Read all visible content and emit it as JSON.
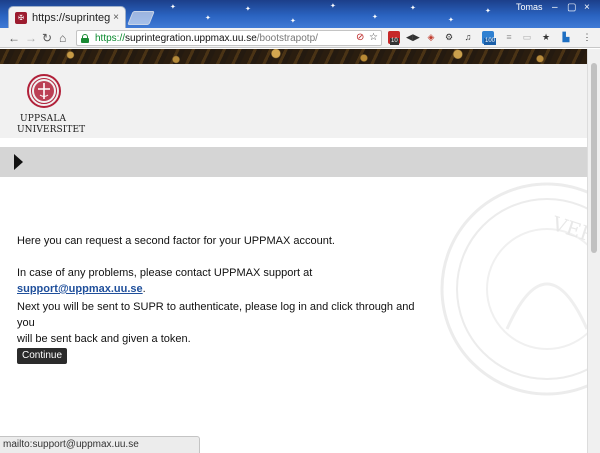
{
  "browser": {
    "tab_title": "https://suprintegra",
    "tab_close": "×",
    "user_label": "Tomas",
    "window_controls": [
      "–",
      "▢",
      "×"
    ],
    "nav": {
      "back": "←",
      "forward": "→",
      "reload": "↻",
      "home": "⌂"
    },
    "url": {
      "secure_prefix": "https://",
      "host": "suprintegration.uppmax.uu.se",
      "path": "/bootstrapotp/"
    },
    "extension_badges": {
      "ext1": "10",
      "ext2": "100"
    },
    "icons": [
      "blocked-popup-icon",
      "bookmark-star-icon",
      "extension-red-icon",
      "arrows-icon",
      "pocket-icon",
      "gear-icon",
      "music-icon",
      "extension-blue-icon",
      "lines-icon",
      "bookmark-star-icon",
      "extension-cast-icon",
      "menu-dots-icon"
    ],
    "status_bar_text": "mailto:support@uppmax.uu.se"
  },
  "logo": {
    "line1": "UPPSALA",
    "line2": "UNIVERSITET",
    "seal_color": "#b1213a"
  },
  "main": {
    "para1": "Here you can request a second factor for your UPPMAX account.",
    "para2_prefix": "In case of any problems, please contact UPPMAX support at ",
    "support_email": "support@uppmax.uu.se",
    "para2_suffix": ".",
    "para3_line1": "Next you will be sent to SUPR to authenticate, please log in and click through and you",
    "para3_line2": "will be sent back and given a token.",
    "continue_label": "Continue"
  },
  "watermark": {
    "letters": "VERITAS UPSALIENSIS"
  },
  "colors": {
    "link": "#1f4f9b",
    "button_bg": "#2b2b2b",
    "menubar_bg": "#d5d5d5",
    "header_bg": "#f1f1f1",
    "secure_green": "#0b8a2f"
  }
}
